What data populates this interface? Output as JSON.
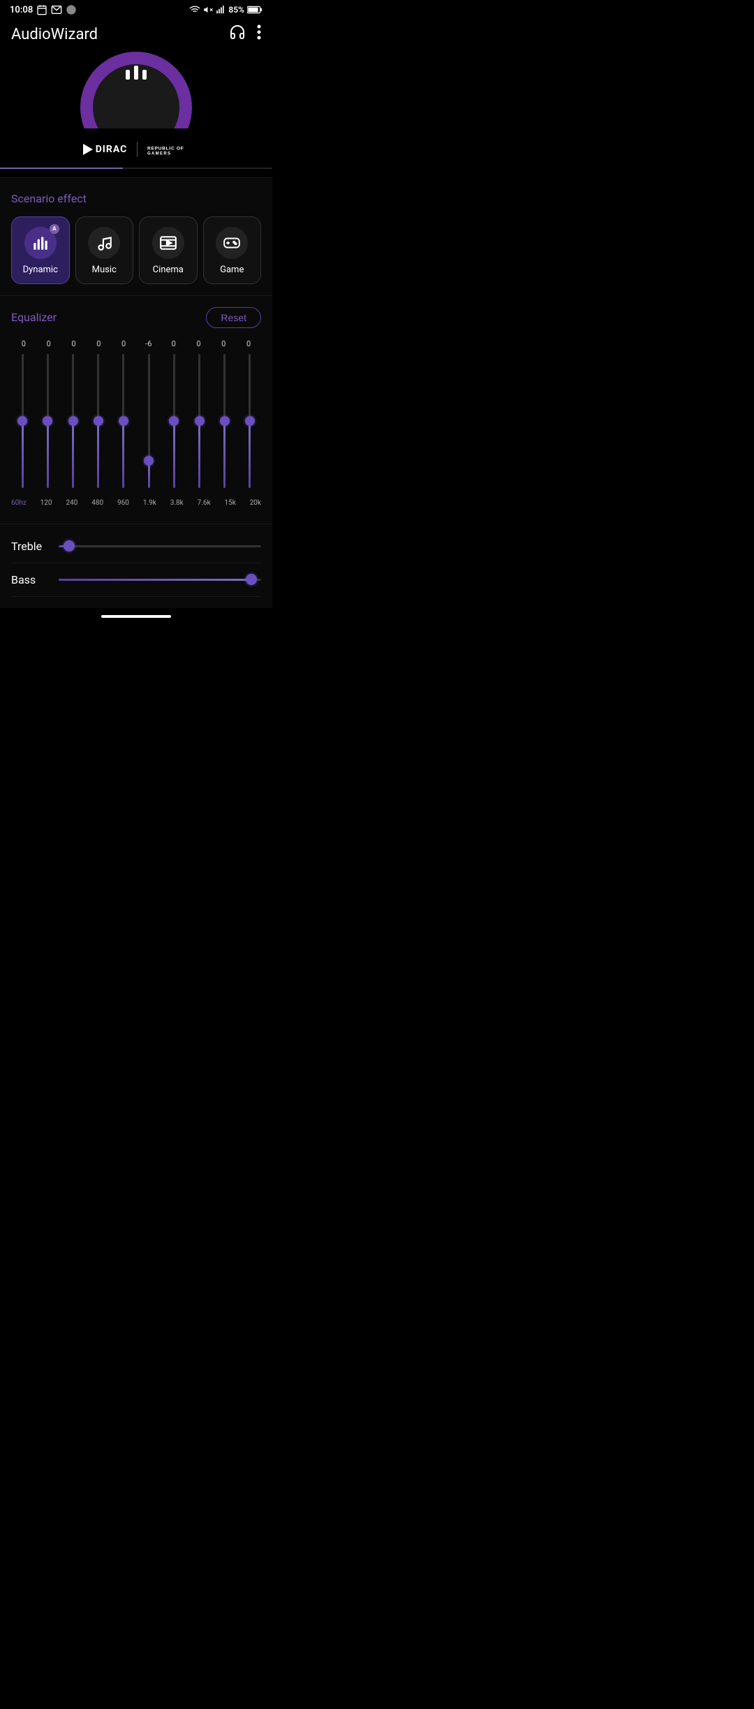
{
  "statusBar": {
    "time": "10:08",
    "battery": "85%"
  },
  "appBar": {
    "title": "AudioWizard"
  },
  "brands": {
    "dirac": "DIRAC",
    "rog": "REPUBLIC OF\nGAMERS"
  },
  "scenario": {
    "title": "Scenario effect",
    "buttons": [
      {
        "id": "dynamic",
        "label": "Dynamic",
        "active": true
      },
      {
        "id": "music",
        "label": "Music",
        "active": false
      },
      {
        "id": "cinema",
        "label": "Cinema",
        "active": false
      },
      {
        "id": "game",
        "label": "Game",
        "active": false
      }
    ]
  },
  "equalizer": {
    "title": "Equalizer",
    "resetLabel": "Reset",
    "bands": [
      {
        "freq": "60hz",
        "value": 0,
        "thumbPos": 50,
        "active": true
      },
      {
        "freq": "120",
        "value": 0,
        "thumbPos": 50,
        "active": false
      },
      {
        "freq": "240",
        "value": 0,
        "thumbPos": 50,
        "active": false
      },
      {
        "freq": "480",
        "value": 0,
        "thumbPos": 50,
        "active": false
      },
      {
        "freq": "960",
        "value": 0,
        "thumbPos": 50,
        "active": false
      },
      {
        "freq": "1.9k",
        "value": -6,
        "thumbPos": 80,
        "active": false
      },
      {
        "freq": "3.8k",
        "value": 0,
        "thumbPos": 50,
        "active": false
      },
      {
        "freq": "7.6k",
        "value": 0,
        "thumbPos": 50,
        "active": false
      },
      {
        "freq": "15k",
        "value": 0,
        "thumbPos": 50,
        "active": false
      },
      {
        "freq": "20k",
        "value": 0,
        "thumbPos": 50,
        "active": false
      }
    ]
  },
  "tone": {
    "treble": {
      "label": "Treble",
      "value": 5,
      "thumbPercent": 5
    },
    "bass": {
      "label": "Bass",
      "value": 95,
      "thumbPercent": 95
    }
  }
}
